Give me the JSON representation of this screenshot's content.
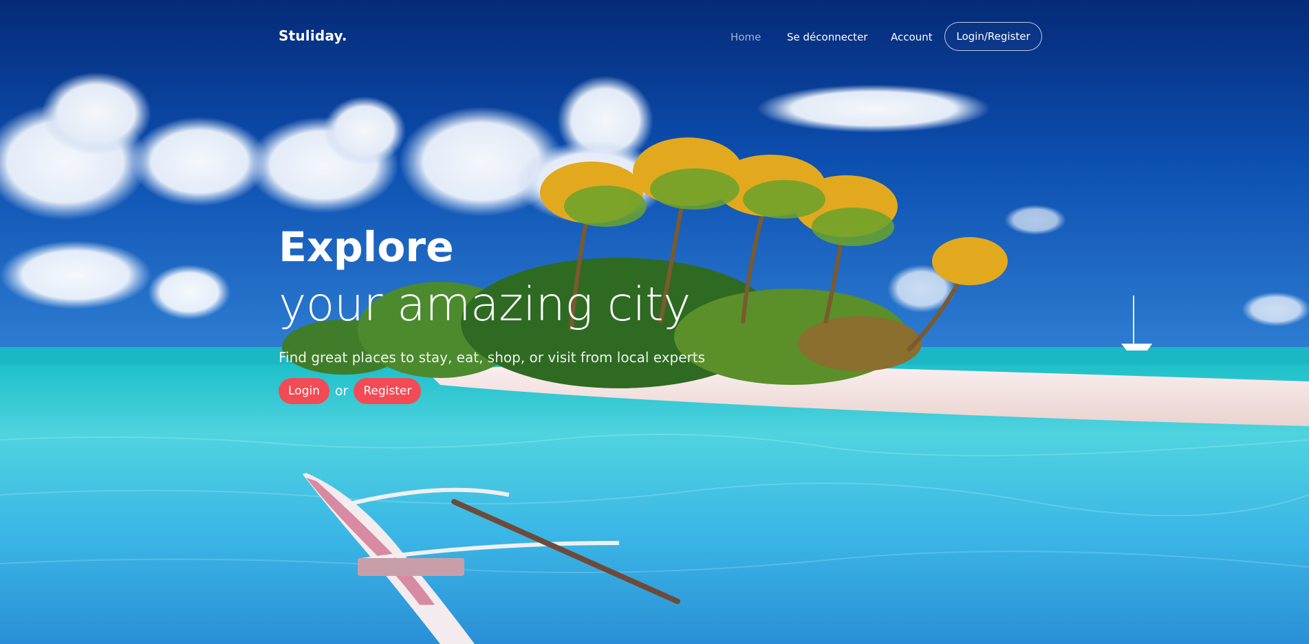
{
  "brand": {
    "name": "Stuliday."
  },
  "nav": {
    "items": [
      {
        "label": "Home",
        "active": true
      },
      {
        "label": "Se déconnecter",
        "active": false
      },
      {
        "label": "Account",
        "active": false
      }
    ],
    "cta_label": "Login/Register"
  },
  "hero": {
    "title_strong": "Explore",
    "title_light": "your amazing city",
    "subtitle": "Find great places to stay, eat, shop, or visit from local experts",
    "login_label": "Login",
    "or_label": "or",
    "register_label": "Register"
  },
  "colors": {
    "accent": "#f24b55",
    "sky": "#0b3f96",
    "lagoon": "#36c6e0"
  },
  "background": {
    "scene": [
      "sky",
      "clouds",
      "palm-island",
      "white-sand-beach",
      "turquoise-lagoon",
      "outrigger-canoe",
      "sailboat"
    ]
  }
}
